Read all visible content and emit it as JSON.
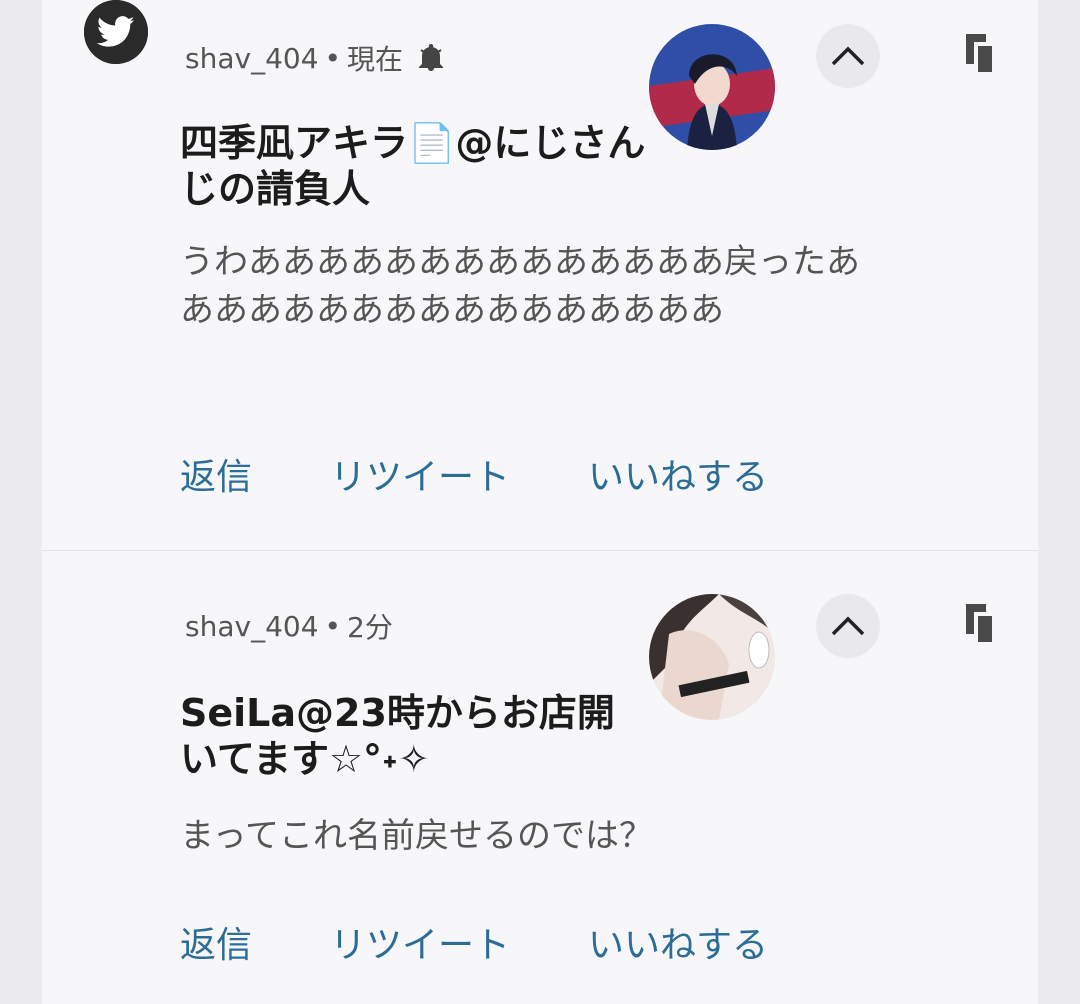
{
  "notifications": [
    {
      "account": "shav_404",
      "separator": "•",
      "time": "現在",
      "title": "四季凪アキラ📄@にじさんじの請負人",
      "message": "うわああああああああああああああ戻ったあああああああああああああああああ",
      "actions": {
        "reply": "返信",
        "retweet": "リツイート",
        "like": "いいねする"
      }
    },
    {
      "account": "shav_404",
      "separator": "•",
      "time": "2分",
      "title": "SeiLa@23時からお店開いてます☆°˖✧",
      "message": "まってこれ名前戻せるのでは？",
      "actions": {
        "reply": "返信",
        "retweet": "リツイート",
        "like": "いいねする"
      }
    }
  ],
  "colors": {
    "accent": "#2b6d96",
    "panel": "#f7f7fa",
    "background": "#ececf0"
  },
  "icons": {
    "app": "twitter-icon",
    "alert": "bell-icon",
    "expand": "chevron-up-icon",
    "copy": "copy-icon"
  }
}
